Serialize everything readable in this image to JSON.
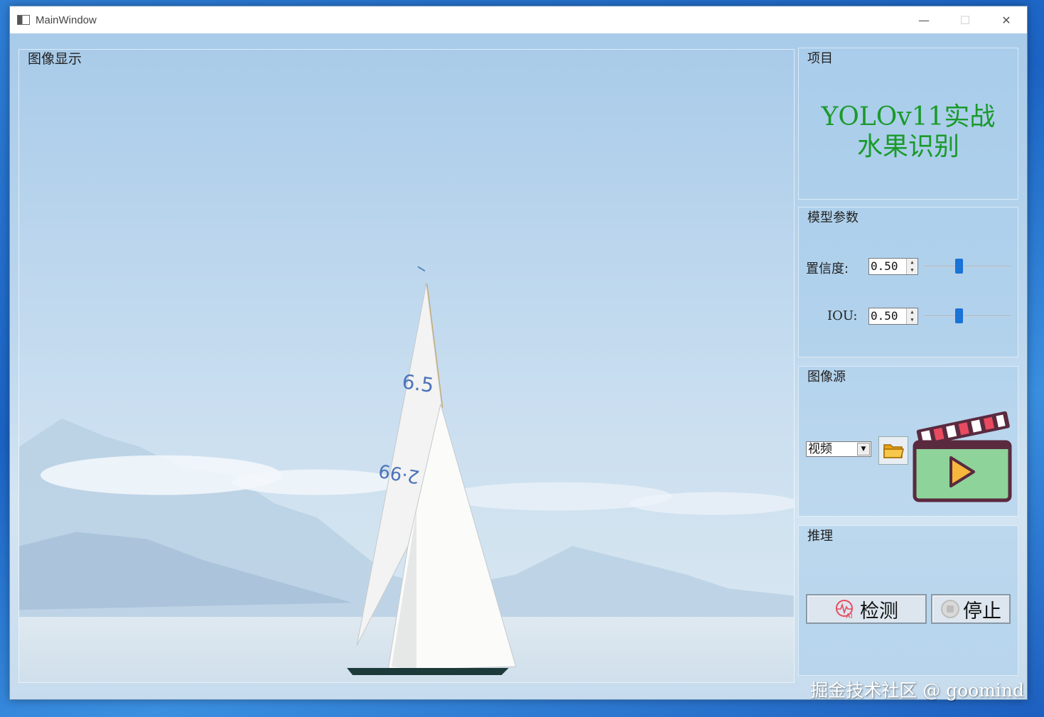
{
  "window": {
    "title": "MainWindow",
    "minimize_glyph": "—",
    "maximize_glyph": "☐",
    "close_glyph": "✕"
  },
  "image_display": {
    "title": "图像显示",
    "sail_numbers_top": "6.5",
    "sail_numbers_bottom": "2·99"
  },
  "project": {
    "title": "项目",
    "line1": "YOLOv11实战",
    "line2": "水果识别"
  },
  "model_params": {
    "title": "模型参数",
    "confidence_label": "置信度:",
    "confidence_value": "0.50",
    "confidence_level": 0.4,
    "iou_label": "IOU:",
    "iou_value": "0.50",
    "iou_level": 0.4
  },
  "image_source": {
    "title": "图像源",
    "source_selected": "视频",
    "folder_icon": "folder-icon",
    "media_icon": "video-clapperboard-icon"
  },
  "inference": {
    "title": "推理",
    "detect_label": "检测",
    "stop_label": "停止"
  },
  "watermark": "掘金技术社区 @ goomind",
  "colors": {
    "project_text": "#1a9a2a",
    "slider_handle": "#1a73d6",
    "clapper_red": "#e84a5f",
    "clapper_green": "#8ed39a"
  }
}
